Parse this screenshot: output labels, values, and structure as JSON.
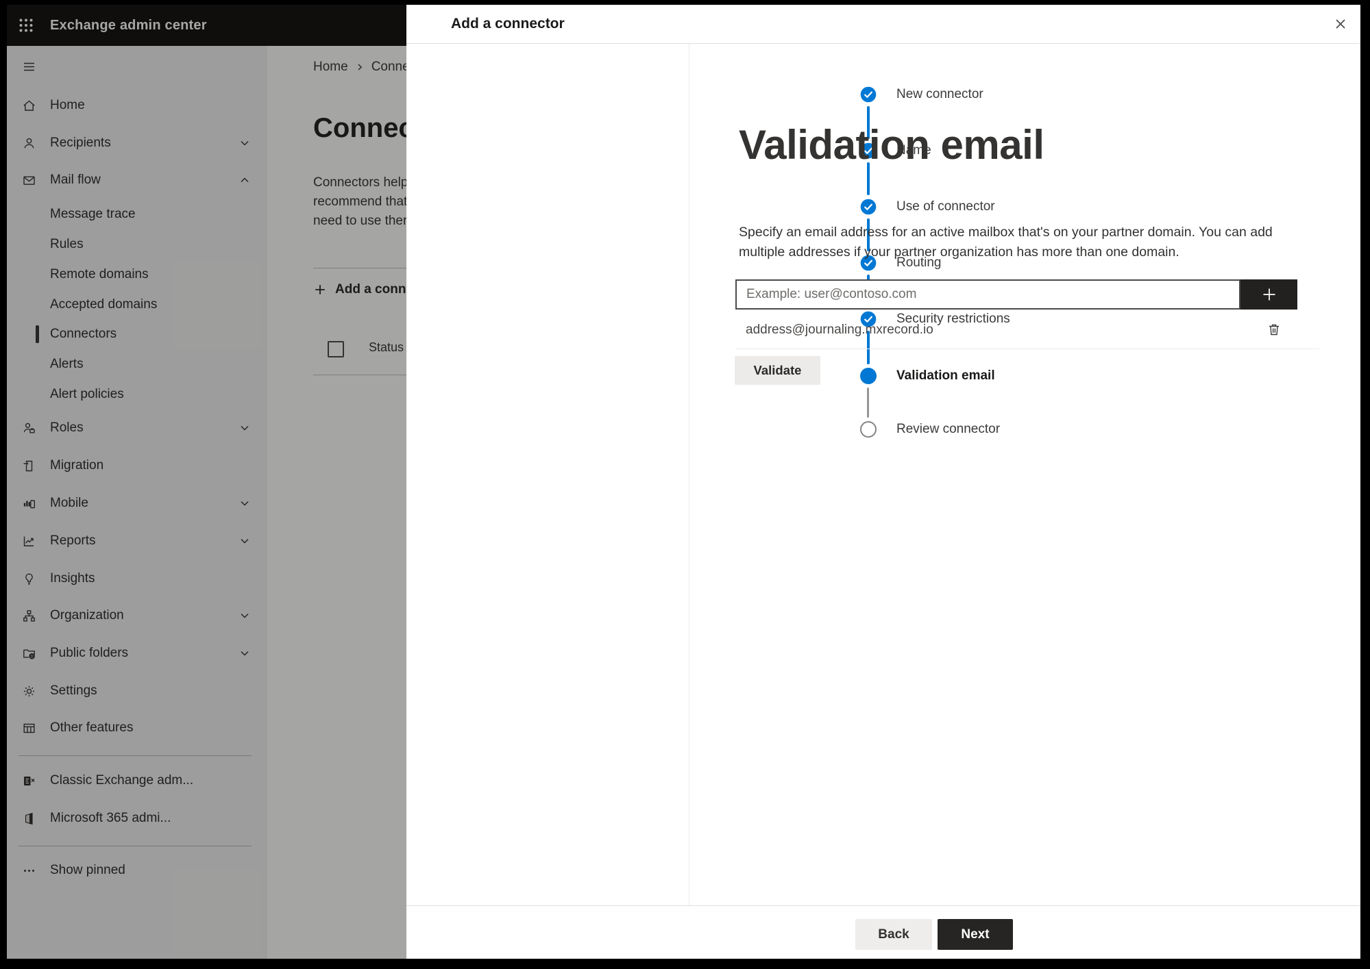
{
  "header": {
    "title": "Exchange admin center"
  },
  "colors": {
    "accent": "#0078d4",
    "topbar": "#171615",
    "step_done": "#0078d4"
  },
  "sidebar": {
    "items": [
      {
        "label": "Home"
      },
      {
        "label": "Recipients"
      },
      {
        "label": "Mail flow"
      },
      {
        "label": "Message trace"
      },
      {
        "label": "Rules"
      },
      {
        "label": "Remote domains"
      },
      {
        "label": "Accepted domains"
      },
      {
        "label": "Connectors",
        "selected": true
      },
      {
        "label": "Alerts"
      },
      {
        "label": "Alert policies"
      },
      {
        "label": "Roles"
      },
      {
        "label": "Migration"
      },
      {
        "label": "Mobile"
      },
      {
        "label": "Reports"
      },
      {
        "label": "Insights"
      },
      {
        "label": "Organization"
      },
      {
        "label": "Public folders"
      },
      {
        "label": "Settings"
      },
      {
        "label": "Other features"
      },
      {
        "label": "Classic Exchange adm..."
      },
      {
        "label": "Microsoft 365 admi..."
      },
      {
        "label": "Show pinned"
      }
    ]
  },
  "background": {
    "breadcrumb_home": "Home",
    "breadcrumb_current": "Conne",
    "page_title": "Connec",
    "intro_lines": "Connectors help\nrecommend that\nneed to use ther",
    "add_button_label": "Add a conn",
    "status_column": "Status"
  },
  "modal": {
    "title": "Add a connector",
    "steps": [
      {
        "label": "New connector",
        "state": "done"
      },
      {
        "label": "Name",
        "state": "done"
      },
      {
        "label": "Use of connector",
        "state": "done"
      },
      {
        "label": "Routing",
        "state": "done"
      },
      {
        "label": "Security restrictions",
        "state": "done"
      },
      {
        "label": "Validation email",
        "state": "current"
      },
      {
        "label": "Review connector",
        "state": "todo"
      }
    ],
    "content": {
      "heading": "Validation email",
      "description": "Specify an email address for an active mailbox that's on your partner domain. You can add\nmultiple addresses if your partner organization has more than one domain.",
      "email_placeholder": "Example: user@contoso.com",
      "addresses": [
        {
          "email": "address@journaling.mxrecord.io"
        }
      ],
      "validate_label": "Validate"
    },
    "footer": {
      "back_label": "Back",
      "next_label": "Next"
    }
  }
}
